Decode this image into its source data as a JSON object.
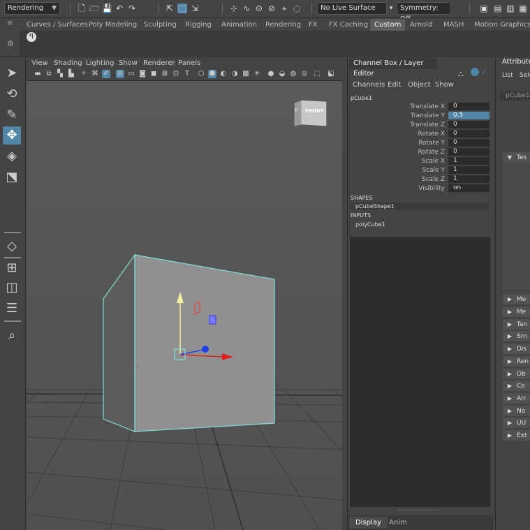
{
  "status_line": {
    "menu_set": "Rendering",
    "live_surface": "No Live Surface",
    "symmetry": "Symmetry: Off"
  },
  "shelf": {
    "tabs": [
      "Curves / Surfaces",
      "Poly Modeling",
      "Sculpting",
      "Rigging",
      "Animation",
      "Rendering",
      "FX",
      "FX Caching",
      "Custom",
      "Arnold",
      "MASH",
      "Motion Graphics"
    ],
    "active_tab": "Custom"
  },
  "viewport": {
    "menu": [
      "View",
      "Shading",
      "Lighting",
      "Show",
      "Renderer",
      "Panels"
    ],
    "view_cube_label": "FRONT",
    "view_cube_side": "P"
  },
  "channel_box": {
    "title": "Channel Box / Layer Editor",
    "menu": [
      "Channels",
      "Edit",
      "Object",
      "Show"
    ],
    "object_name": "pCube1",
    "attributes": [
      {
        "label": "Translate X",
        "value": "0"
      },
      {
        "label": "Translate Y",
        "value": "0.5"
      },
      {
        "label": "Translate Z",
        "value": "0"
      },
      {
        "label": "Rotate X",
        "value": "0"
      },
      {
        "label": "Rotate Y",
        "value": "0"
      },
      {
        "label": "Rotate Z",
        "value": "0"
      },
      {
        "label": "Scale X",
        "value": "1"
      },
      {
        "label": "Scale Y",
        "value": "1"
      },
      {
        "label": "Scale Z",
        "value": "1"
      },
      {
        "label": "Visibility",
        "value": "on"
      }
    ],
    "selected_attribute": "Translate Y",
    "shapes_heading": "SHAPES",
    "shape_node": "pCubeShape1",
    "inputs_heading": "INPUTS",
    "input_node": "polyCube1",
    "layer_tabs": [
      "Display",
      "Anim"
    ],
    "active_layer_tab": "Display"
  },
  "attribute_editor": {
    "title": "Attribute",
    "menu": [
      "List",
      "Sele"
    ],
    "node_tab": "pCube1",
    "sections": [
      "Tes",
      "Me",
      "Me",
      "Tan",
      "Sm",
      "Dis",
      "Ren",
      "Ob",
      "Co",
      "Arr",
      "No",
      "UU",
      "Ext"
    ]
  },
  "colors": {
    "accent": "#5285a6",
    "selection_wire": "#7fe0d0",
    "x_axis": "#e02020",
    "y_axis": "#f0f0a0",
    "z_axis": "#2040e0"
  }
}
